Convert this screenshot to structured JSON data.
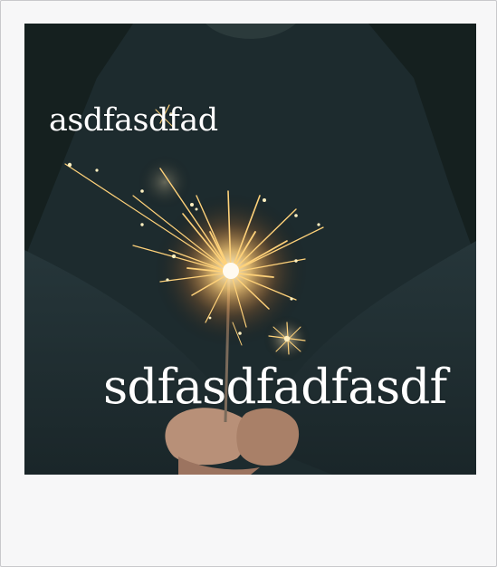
{
  "captions": {
    "top": "asdfasdfad",
    "bottom": "sdfasdfadfasdf"
  },
  "photo": {
    "subject": "hands holding a lit sparkler"
  },
  "colors": {
    "frame_background": "#f7f7f8",
    "caption_text": "#ffffff",
    "spark": "#ffd27a",
    "spark_core": "#fff3c8",
    "sweater": "#1d2b2f"
  }
}
